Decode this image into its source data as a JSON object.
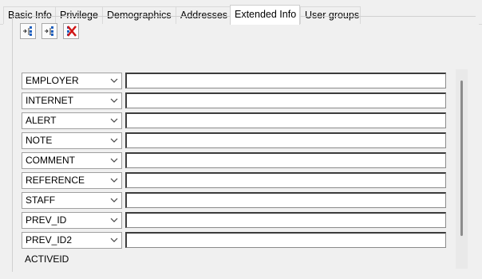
{
  "tabs": [
    "Basic Info",
    "Privilege",
    "Demographics",
    "Addresses",
    "Extended Info",
    "User groups"
  ],
  "active_tab": "Extended Info",
  "toolbar": {
    "icons": [
      "add-field-icon",
      "insert-field-icon",
      "delete-field-icon"
    ]
  },
  "fields": [
    {
      "key": "EMPLOYER",
      "value": ""
    },
    {
      "key": "INTERNET",
      "value": ""
    },
    {
      "key": "ALERT",
      "value": ""
    },
    {
      "key": "NOTE",
      "value": ""
    },
    {
      "key": "COMMENT",
      "value": ""
    },
    {
      "key": "REFERENCE",
      "value": ""
    },
    {
      "key": "STAFF",
      "value": ""
    },
    {
      "key": "PREV_ID",
      "value": ""
    },
    {
      "key": "PREV_ID2",
      "value": ""
    }
  ],
  "partial_field": "ACTIVEID"
}
